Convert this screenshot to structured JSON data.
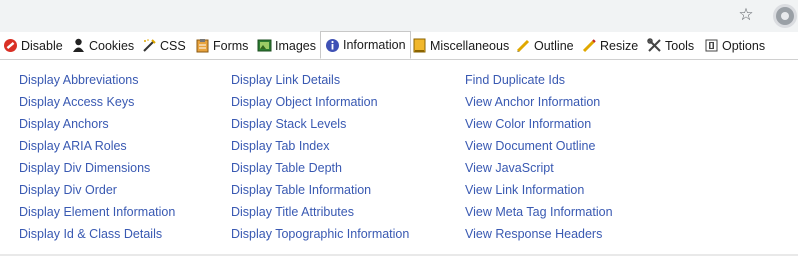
{
  "toolbar": {
    "tabs": [
      {
        "label": "Disable",
        "icon": "disable-icon"
      },
      {
        "label": "Cookies",
        "icon": "cookies-icon"
      },
      {
        "label": "CSS",
        "icon": "css-icon"
      },
      {
        "label": "Forms",
        "icon": "forms-icon"
      },
      {
        "label": "Images",
        "icon": "images-icon"
      },
      {
        "label": "Information",
        "icon": "information-icon"
      },
      {
        "label": "Miscellaneous",
        "icon": "miscellaneous-icon"
      },
      {
        "label": "Outline",
        "icon": "outline-icon"
      },
      {
        "label": "Resize",
        "icon": "resize-icon"
      },
      {
        "label": "Tools",
        "icon": "tools-icon"
      },
      {
        "label": "Options",
        "icon": "options-icon"
      }
    ],
    "active_tab": "Information"
  },
  "menu": {
    "columns": [
      [
        "Display Abbreviations",
        "Display Access Keys",
        "Display Anchors",
        "Display ARIA Roles",
        "Display Div Dimensions",
        "Display Div Order",
        "Display Element Information",
        "Display Id & Class Details"
      ],
      [
        "Display Link Details",
        "Display Object Information",
        "Display Stack Levels",
        "Display Tab Index",
        "Display Table Depth",
        "Display Table Information",
        "Display Title Attributes",
        "Display Topographic Information"
      ],
      [
        "Find Duplicate Ids",
        "View Anchor Information",
        "View Color Information",
        "View Document Outline",
        "View JavaScript",
        "View Link Information",
        "View Meta Tag Information",
        "View Response Headers"
      ]
    ]
  },
  "browser": {
    "bookmark_icon": "star-icon",
    "extension_icon": "gear-icon"
  },
  "colors": {
    "link": "#3959b2",
    "topbar_bg": "#f1f3f4",
    "disable_red": "#d93025",
    "info_blue": "#3f51b5"
  }
}
